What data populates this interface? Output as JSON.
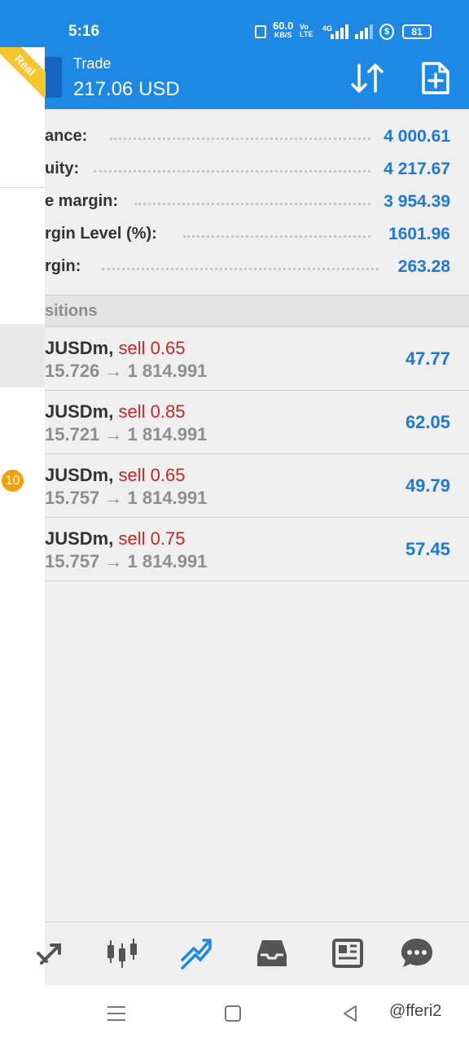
{
  "status_bar": {
    "time": "5:16",
    "speed_value": "60.0",
    "speed_unit": "KB/S",
    "volte_top": "Vo",
    "volte_bottom": "LTE",
    "network": "4G",
    "battery": "81"
  },
  "header": {
    "ribbon": "Real",
    "title": "Trade",
    "subtitle": "217.06 USD"
  },
  "summary": [
    {
      "label": "ance:",
      "value": "4 000.61"
    },
    {
      "label": "uity:",
      "value": "4 217.67"
    },
    {
      "label": "e margin:",
      "value": "3 954.39"
    },
    {
      "label": "rgin Level (%):",
      "value": "1601.96"
    },
    {
      "label": "rgin:",
      "value": "263.28"
    }
  ],
  "positions_header": "sitions",
  "positions": [
    {
      "symbol": "JUSDm,",
      "side": "sell 0.65",
      "open": "15.726",
      "arrow": "→",
      "current": "1 814.991",
      "profit": "47.77"
    },
    {
      "symbol": "JUSDm,",
      "side": "sell 0.85",
      "open": "15.721",
      "arrow": "→",
      "current": "1 814.991",
      "profit": "62.05"
    },
    {
      "symbol": "JUSDm,",
      "side": "sell 0.65",
      "open": "15.757",
      "arrow": "→",
      "current": "1 814.991",
      "profit": "49.79"
    },
    {
      "symbol": "JUSDm,",
      "side": "sell 0.75",
      "open": "15.757",
      "arrow": "→",
      "current": "1 814.991",
      "profit": "57.45"
    }
  ],
  "drawer": {
    "badge": "10"
  },
  "bottom_nav": [
    "quotes-icon",
    "chart-icon",
    "trade-icon",
    "history-icon",
    "news-icon",
    "chat-icon"
  ],
  "watermark": "@fferi2",
  "colors": {
    "accent": "#1e88e5",
    "profit": "#1e78d6",
    "sell": "#c62828",
    "ribbon": "#f7c62f",
    "badge": "#f5a000"
  }
}
